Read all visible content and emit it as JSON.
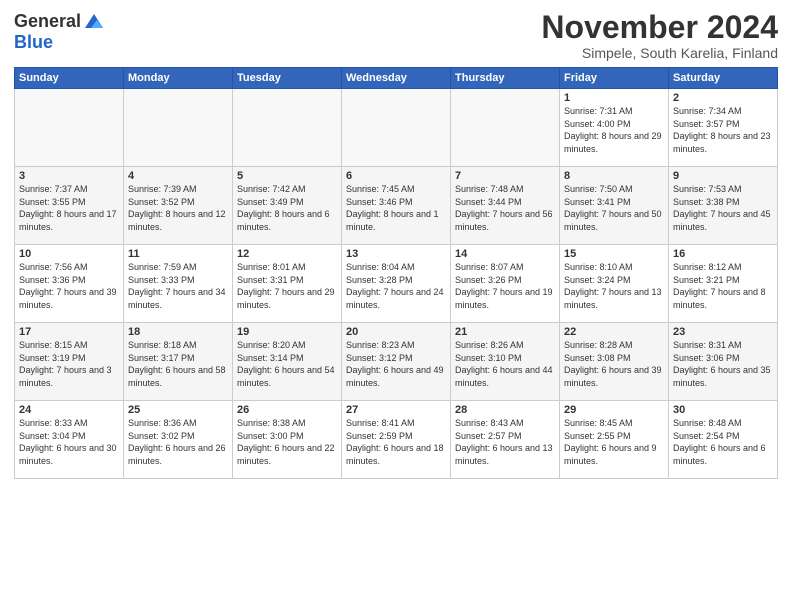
{
  "logo": {
    "general": "General",
    "blue": "Blue"
  },
  "title": "November 2024",
  "subtitle": "Simpele, South Karelia, Finland",
  "headers": [
    "Sunday",
    "Monday",
    "Tuesday",
    "Wednesday",
    "Thursday",
    "Friday",
    "Saturday"
  ],
  "weeks": [
    [
      {
        "day": "",
        "sunrise": "",
        "sunset": "",
        "daylight": ""
      },
      {
        "day": "",
        "sunrise": "",
        "sunset": "",
        "daylight": ""
      },
      {
        "day": "",
        "sunrise": "",
        "sunset": "",
        "daylight": ""
      },
      {
        "day": "",
        "sunrise": "",
        "sunset": "",
        "daylight": ""
      },
      {
        "day": "",
        "sunrise": "",
        "sunset": "",
        "daylight": ""
      },
      {
        "day": "1",
        "sunrise": "Sunrise: 7:31 AM",
        "sunset": "Sunset: 4:00 PM",
        "daylight": "Daylight: 8 hours and 29 minutes."
      },
      {
        "day": "2",
        "sunrise": "Sunrise: 7:34 AM",
        "sunset": "Sunset: 3:57 PM",
        "daylight": "Daylight: 8 hours and 23 minutes."
      }
    ],
    [
      {
        "day": "3",
        "sunrise": "Sunrise: 7:37 AM",
        "sunset": "Sunset: 3:55 PM",
        "daylight": "Daylight: 8 hours and 17 minutes."
      },
      {
        "day": "4",
        "sunrise": "Sunrise: 7:39 AM",
        "sunset": "Sunset: 3:52 PM",
        "daylight": "Daylight: 8 hours and 12 minutes."
      },
      {
        "day": "5",
        "sunrise": "Sunrise: 7:42 AM",
        "sunset": "Sunset: 3:49 PM",
        "daylight": "Daylight: 8 hours and 6 minutes."
      },
      {
        "day": "6",
        "sunrise": "Sunrise: 7:45 AM",
        "sunset": "Sunset: 3:46 PM",
        "daylight": "Daylight: 8 hours and 1 minute."
      },
      {
        "day": "7",
        "sunrise": "Sunrise: 7:48 AM",
        "sunset": "Sunset: 3:44 PM",
        "daylight": "Daylight: 7 hours and 56 minutes."
      },
      {
        "day": "8",
        "sunrise": "Sunrise: 7:50 AM",
        "sunset": "Sunset: 3:41 PM",
        "daylight": "Daylight: 7 hours and 50 minutes."
      },
      {
        "day": "9",
        "sunrise": "Sunrise: 7:53 AM",
        "sunset": "Sunset: 3:38 PM",
        "daylight": "Daylight: 7 hours and 45 minutes."
      }
    ],
    [
      {
        "day": "10",
        "sunrise": "Sunrise: 7:56 AM",
        "sunset": "Sunset: 3:36 PM",
        "daylight": "Daylight: 7 hours and 39 minutes."
      },
      {
        "day": "11",
        "sunrise": "Sunrise: 7:59 AM",
        "sunset": "Sunset: 3:33 PM",
        "daylight": "Daylight: 7 hours and 34 minutes."
      },
      {
        "day": "12",
        "sunrise": "Sunrise: 8:01 AM",
        "sunset": "Sunset: 3:31 PM",
        "daylight": "Daylight: 7 hours and 29 minutes."
      },
      {
        "day": "13",
        "sunrise": "Sunrise: 8:04 AM",
        "sunset": "Sunset: 3:28 PM",
        "daylight": "Daylight: 7 hours and 24 minutes."
      },
      {
        "day": "14",
        "sunrise": "Sunrise: 8:07 AM",
        "sunset": "Sunset: 3:26 PM",
        "daylight": "Daylight: 7 hours and 19 minutes."
      },
      {
        "day": "15",
        "sunrise": "Sunrise: 8:10 AM",
        "sunset": "Sunset: 3:24 PM",
        "daylight": "Daylight: 7 hours and 13 minutes."
      },
      {
        "day": "16",
        "sunrise": "Sunrise: 8:12 AM",
        "sunset": "Sunset: 3:21 PM",
        "daylight": "Daylight: 7 hours and 8 minutes."
      }
    ],
    [
      {
        "day": "17",
        "sunrise": "Sunrise: 8:15 AM",
        "sunset": "Sunset: 3:19 PM",
        "daylight": "Daylight: 7 hours and 3 minutes."
      },
      {
        "day": "18",
        "sunrise": "Sunrise: 8:18 AM",
        "sunset": "Sunset: 3:17 PM",
        "daylight": "Daylight: 6 hours and 58 minutes."
      },
      {
        "day": "19",
        "sunrise": "Sunrise: 8:20 AM",
        "sunset": "Sunset: 3:14 PM",
        "daylight": "Daylight: 6 hours and 54 minutes."
      },
      {
        "day": "20",
        "sunrise": "Sunrise: 8:23 AM",
        "sunset": "Sunset: 3:12 PM",
        "daylight": "Daylight: 6 hours and 49 minutes."
      },
      {
        "day": "21",
        "sunrise": "Sunrise: 8:26 AM",
        "sunset": "Sunset: 3:10 PM",
        "daylight": "Daylight: 6 hours and 44 minutes."
      },
      {
        "day": "22",
        "sunrise": "Sunrise: 8:28 AM",
        "sunset": "Sunset: 3:08 PM",
        "daylight": "Daylight: 6 hours and 39 minutes."
      },
      {
        "day": "23",
        "sunrise": "Sunrise: 8:31 AM",
        "sunset": "Sunset: 3:06 PM",
        "daylight": "Daylight: 6 hours and 35 minutes."
      }
    ],
    [
      {
        "day": "24",
        "sunrise": "Sunrise: 8:33 AM",
        "sunset": "Sunset: 3:04 PM",
        "daylight": "Daylight: 6 hours and 30 minutes."
      },
      {
        "day": "25",
        "sunrise": "Sunrise: 8:36 AM",
        "sunset": "Sunset: 3:02 PM",
        "daylight": "Daylight: 6 hours and 26 minutes."
      },
      {
        "day": "26",
        "sunrise": "Sunrise: 8:38 AM",
        "sunset": "Sunset: 3:00 PM",
        "daylight": "Daylight: 6 hours and 22 minutes."
      },
      {
        "day": "27",
        "sunrise": "Sunrise: 8:41 AM",
        "sunset": "Sunset: 2:59 PM",
        "daylight": "Daylight: 6 hours and 18 minutes."
      },
      {
        "day": "28",
        "sunrise": "Sunrise: 8:43 AM",
        "sunset": "Sunset: 2:57 PM",
        "daylight": "Daylight: 6 hours and 13 minutes."
      },
      {
        "day": "29",
        "sunrise": "Sunrise: 8:45 AM",
        "sunset": "Sunset: 2:55 PM",
        "daylight": "Daylight: 6 hours and 9 minutes."
      },
      {
        "day": "30",
        "sunrise": "Sunrise: 8:48 AM",
        "sunset": "Sunset: 2:54 PM",
        "daylight": "Daylight: 6 hours and 6 minutes."
      }
    ]
  ]
}
